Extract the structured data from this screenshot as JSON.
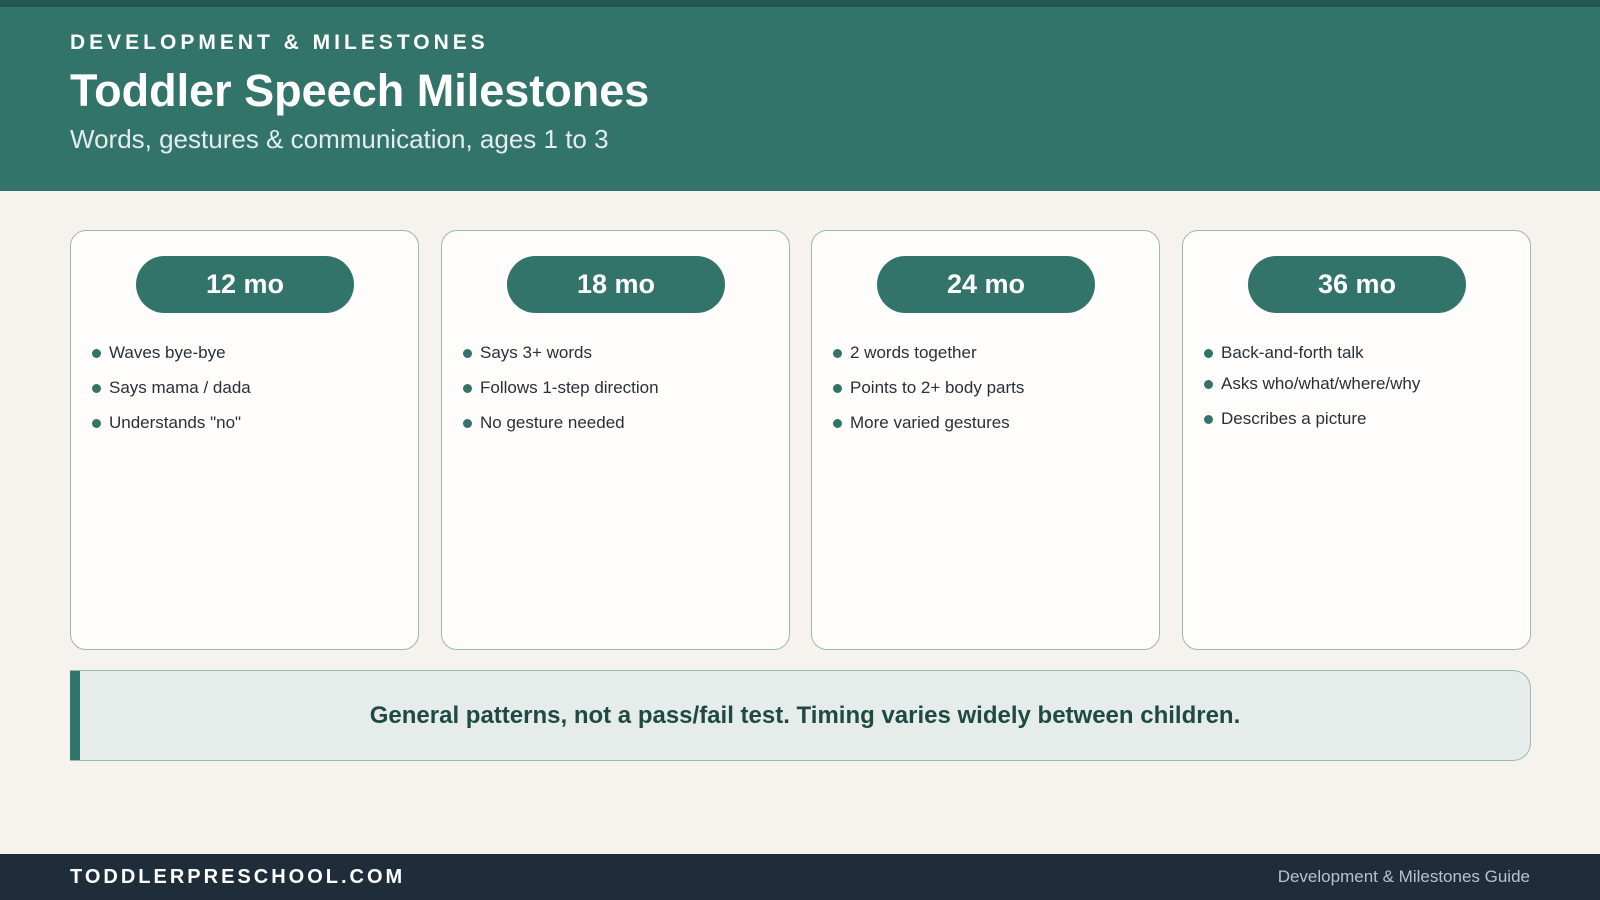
{
  "header": {
    "kicker": "DEVELOPMENT & MILESTONES",
    "title": "Toddler Speech Milestones",
    "subtitle": "Words, gestures & communication, ages 1 to 3"
  },
  "milestones": [
    {
      "age": "12 mo",
      "items": [
        "Waves bye-bye",
        "Says mama / dada",
        "Understands \"no\""
      ]
    },
    {
      "age": "18 mo",
      "items": [
        "Says 3+ words",
        "Follows 1-step direction",
        "No gesture needed"
      ]
    },
    {
      "age": "24 mo",
      "items": [
        "2 words together",
        "Points to 2+ body parts",
        "More varied gestures"
      ]
    },
    {
      "age": "36 mo",
      "items": [
        "Back-and-forth talk",
        "Asks who/what/where/why",
        "Describes a picture"
      ]
    }
  ],
  "note": {
    "text": "General patterns, not a pass/fail test. Timing varies widely between children."
  },
  "footer": {
    "site": "TODDLERPRESCHOOL.COM",
    "guide": "Development & Milestones Guide"
  },
  "colors": {
    "primary": "#32736a",
    "dark_strip": "#24574f",
    "background": "#f6f2ee",
    "footer": "#1f2d3a",
    "note_bg": "#e6ecea",
    "note_text": "#1f4a44"
  }
}
